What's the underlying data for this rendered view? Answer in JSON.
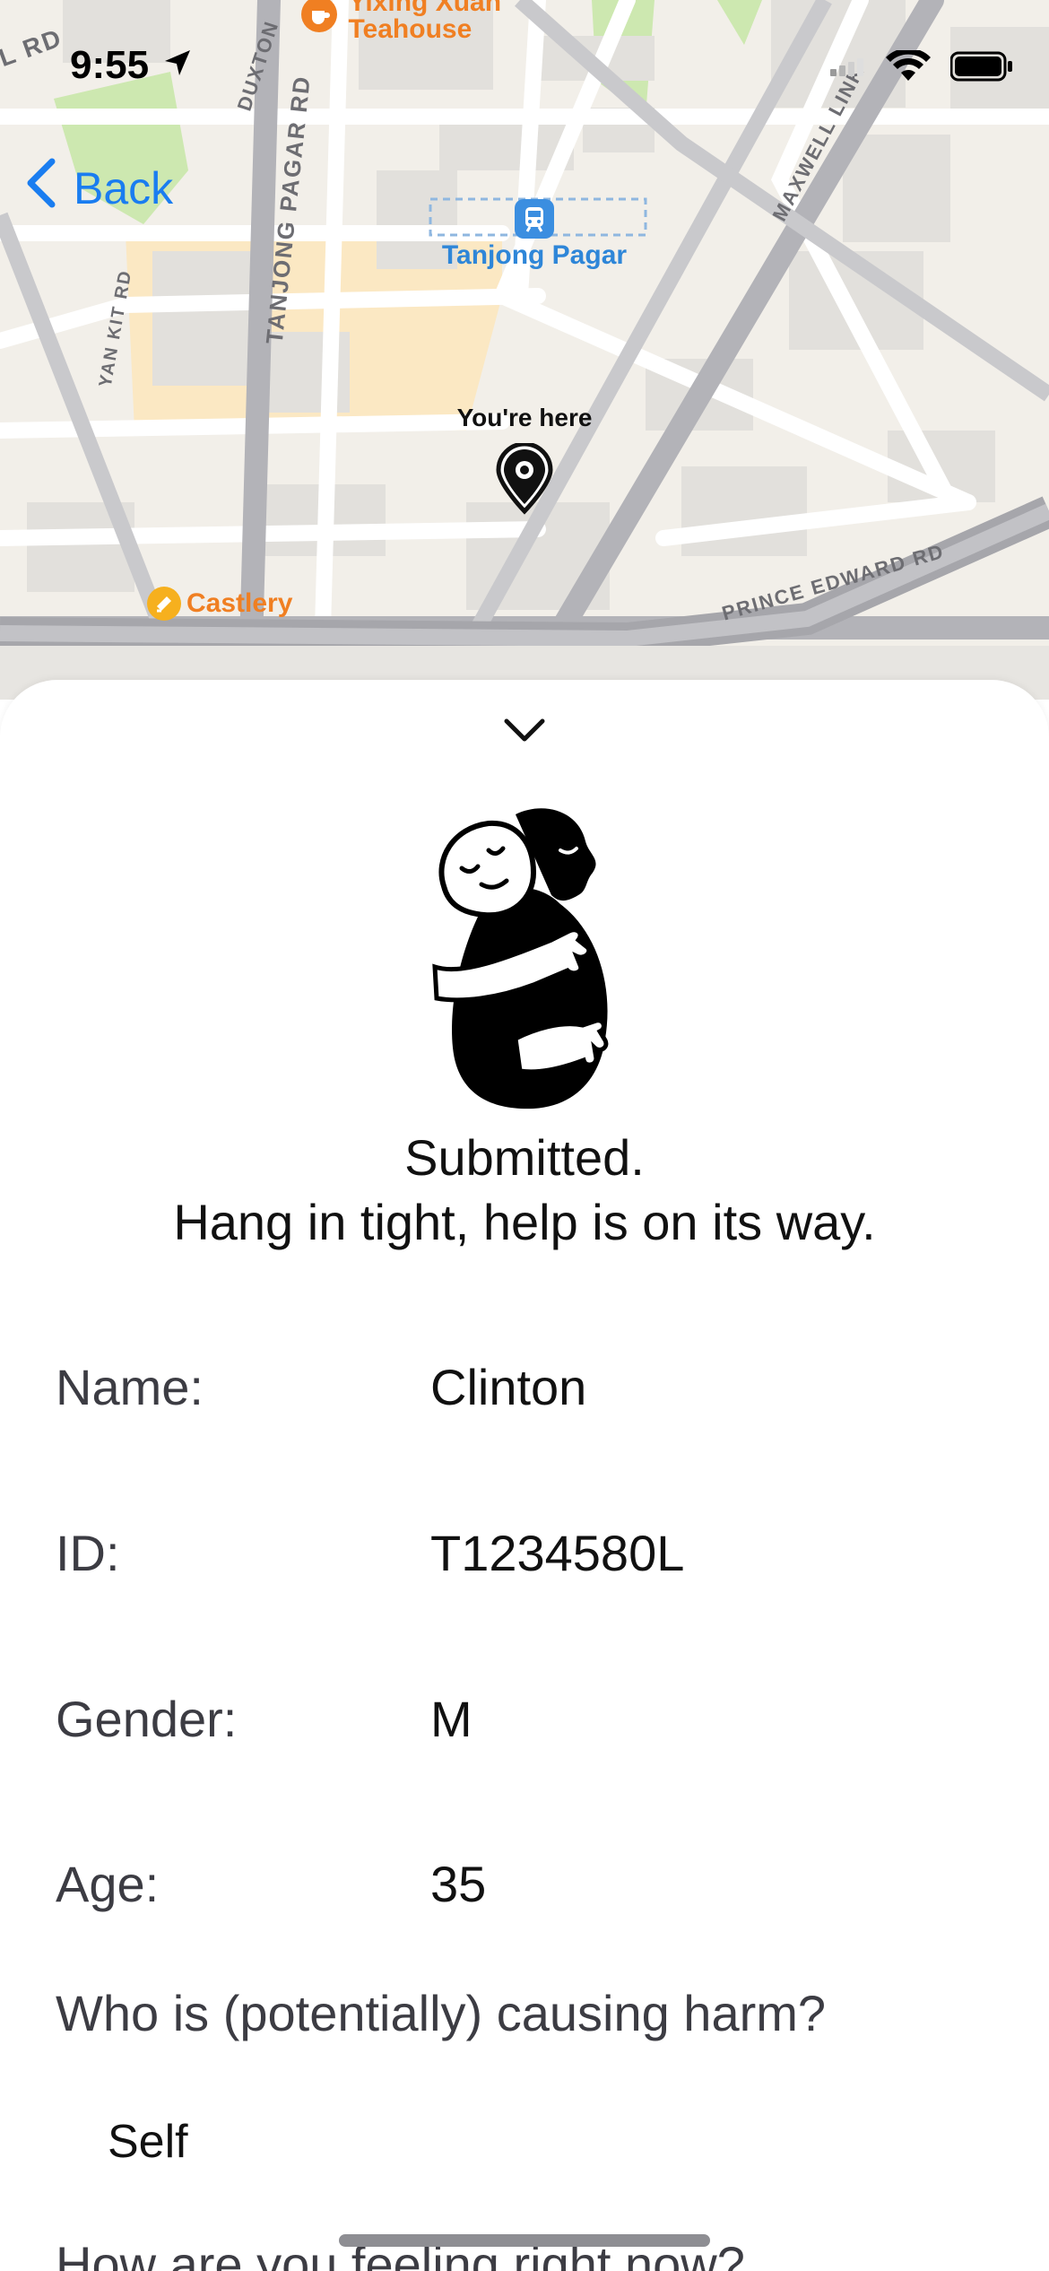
{
  "status_bar": {
    "time": "9:55"
  },
  "nav": {
    "back_label": "Back"
  },
  "map": {
    "streets": [
      "DUXTON",
      "TANJONG PAGAR RD",
      "YAN KIT RD",
      "MAXWELL LINK",
      "PRINCE EDWARD RD",
      "L RD"
    ],
    "pois": {
      "teahouse_line1": "Yixing Xuan",
      "teahouse_line2": "Teahouse",
      "station": "Tanjong Pagar",
      "castlery": "Castlery"
    },
    "marker_label": "You're here"
  },
  "confirmation": {
    "line1": "Submitted.",
    "line2": "Hang in tight, help is on its way."
  },
  "details": {
    "name_label": "Name:",
    "name_value": "Clinton",
    "id_label": "ID:",
    "id_value": "T1234580L",
    "gender_label": "Gender:",
    "gender_value": "M",
    "age_label": "Age:",
    "age_value": "35"
  },
  "questions": {
    "harm_question": "Who is (potentially) causing harm?",
    "harm_answer": "Self",
    "feeling_question": "How are you feeling right now?"
  },
  "icons": [
    "location-arrow-icon",
    "cellular-icon",
    "wifi-icon",
    "battery-icon",
    "chevron-left-icon",
    "chevron-down-icon",
    "map-pin-icon",
    "train-icon",
    "teahouse-icon",
    "store-icon"
  ],
  "colors": {
    "accent": "#1a7df0",
    "poi_orange": "#f07f22",
    "poi_blue": "#2e86d8"
  }
}
